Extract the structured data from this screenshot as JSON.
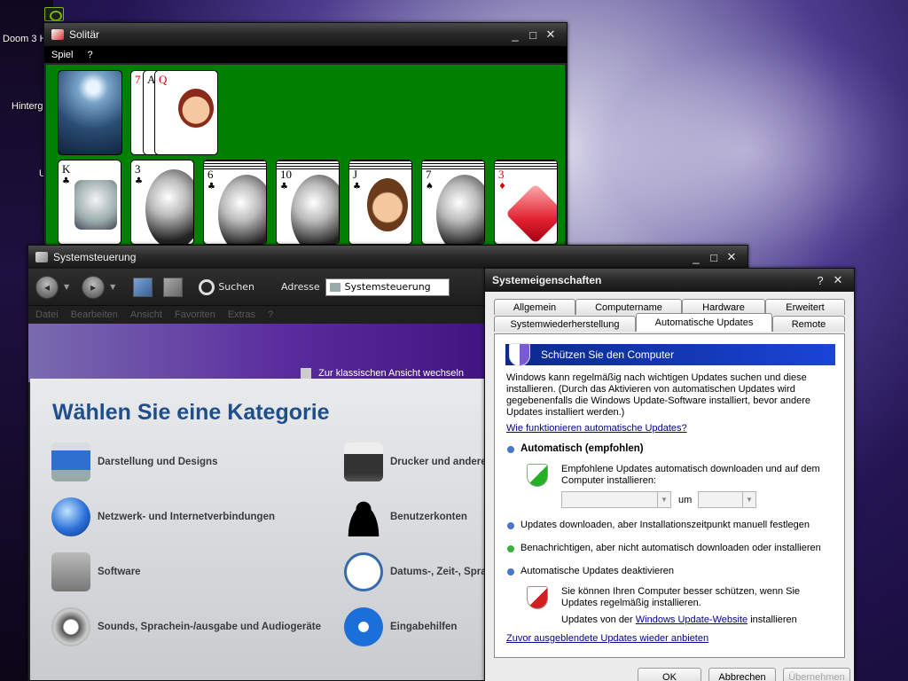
{
  "desktop": {
    "icons": [
      {
        "label": "Doom 3 H"
      },
      {
        "label": "Hinterg"
      },
      {
        "label": "U"
      }
    ]
  },
  "solitaire": {
    "title": "Solitär",
    "menu": [
      "Spiel",
      "?"
    ],
    "foundation": [
      {
        "rank": "7",
        "color": "red"
      },
      {
        "rank": "A",
        "color": "black"
      },
      {
        "rank": "Q",
        "color": "red"
      }
    ],
    "tableau": [
      {
        "rank": "K",
        "suit": "♣",
        "color": "black"
      },
      {
        "rank": "3",
        "suit": "♣",
        "color": "black"
      },
      {
        "rank": "6",
        "suit": "♣",
        "color": "black"
      },
      {
        "rank": "10",
        "suit": "♣",
        "color": "black"
      },
      {
        "rank": "J",
        "suit": "♣",
        "color": "black"
      },
      {
        "rank": "7",
        "suit": "♠",
        "color": "black"
      },
      {
        "rank": "3",
        "suit": "♦",
        "color": "red"
      }
    ]
  },
  "control_panel": {
    "title": "Systemsteuerung",
    "toolbar": {
      "search": "Suchen",
      "address_label": "Adresse",
      "address_value": "Systemsteuerung"
    },
    "menu": [
      "Datei",
      "Bearbeiten",
      "Ansicht",
      "Favoriten",
      "Extras",
      "?"
    ],
    "switch_view": "Zur klassischen Ansicht wechseln",
    "heading": "Wählen Sie eine Kategorie",
    "categories_left": [
      {
        "label": "Darstellung und Designs",
        "icon": "monitor-icon"
      },
      {
        "label": "Netzwerk- und Internetverbindungen",
        "icon": "globe-icon"
      },
      {
        "label": "Software",
        "icon": "software-icon"
      },
      {
        "label": "Sounds, Sprachein-/ausgabe und Audiogeräte",
        "icon": "speakers-icon"
      }
    ],
    "categories_right": [
      {
        "label": "Drucker und andere",
        "icon": "printer-icon"
      },
      {
        "label": "Benutzerkonten",
        "icon": "user-icon"
      },
      {
        "label": "Datums-, Zeit-, Spra",
        "icon": "clock-icon"
      },
      {
        "label": "Eingabehilfen",
        "icon": "accessibility-icon"
      }
    ]
  },
  "system_properties": {
    "title": "Systemeigenschaften",
    "tabs_row1": [
      "Allgemein",
      "Computername",
      "Hardware",
      "Erweitert"
    ],
    "tabs_row2": [
      "Systemwiederherstellung",
      "Automatische Updates",
      "Remote"
    ],
    "header": "Schützen Sie den Computer",
    "intro": "Windows kann regelmäßig nach wichtigen Updates suchen und diese installieren. (Durch das Aktivieren von automatischen Updates wird gegebenenfalls die Windows Update-Software installiert, bevor andere Updates installiert werden.)",
    "how_link": "Wie funktionieren automatische Updates?",
    "options": {
      "auto": "Automatisch (empfohlen)",
      "auto_desc": "Empfohlene Updates automatisch downloaden und auf dem Computer installieren:",
      "um": "um",
      "download": "Updates downloaden, aber Installationszeitpunkt manuell festlegen",
      "notify": "Benachrichtigen, aber nicht automatisch downloaden oder installieren",
      "off": "Automatische Updates deaktivieren"
    },
    "warning": "Sie können Ihren Computer besser schützen, wenn Sie Updates regelmäßig installieren.",
    "update_prefix": "Updates von der",
    "update_link": "Windows Update-Website",
    "update_suffix": "installieren",
    "hidden_link": "Zuvor ausgeblendete Updates wieder anbieten",
    "buttons": {
      "ok": "OK",
      "cancel": "Abbrechen",
      "apply": "Übernehmen"
    }
  }
}
